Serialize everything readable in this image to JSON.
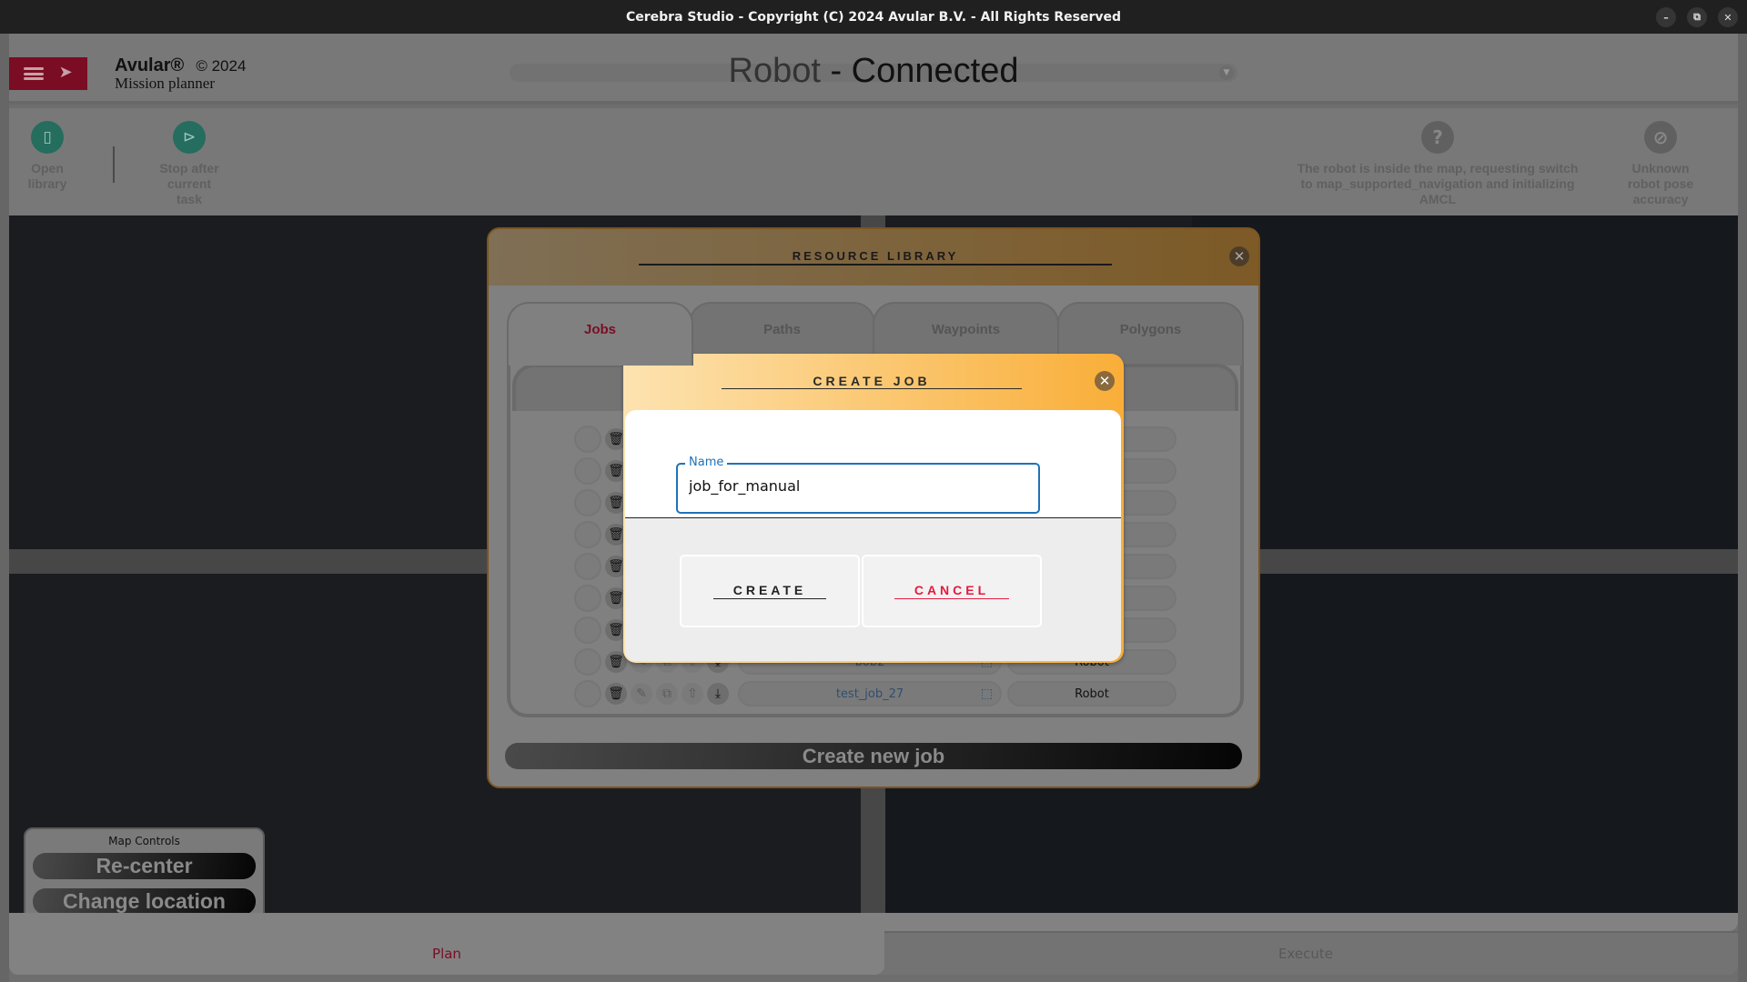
{
  "window": {
    "title": "Cerebra Studio - Copyright (C) 2024 Avular B.V. - All Rights Reserved",
    "controls": {
      "minimize": "–",
      "restore": "⧉",
      "close": "✕"
    }
  },
  "header": {
    "brand_name": "Avular®",
    "brand_copyright": "© 2024",
    "brand_subtitle": "Mission planner",
    "robot_name": "Robot",
    "robot_status": " - Connected",
    "dropdown_arrow": "▼"
  },
  "toolbar": {
    "open_library": {
      "label_line1": "Open",
      "label_line2": "library",
      "icon": "book-icon"
    },
    "stop_after_task": {
      "label_line1": "Stop after",
      "label_line2": "current",
      "label_line3": "task",
      "icon": "stop-after-task-icon"
    },
    "status_message": {
      "line1": "The robot is inside the map, requesting switch",
      "line2": "to map_supported_navigation and initializing",
      "line3": "AMCL",
      "icon": "question-icon"
    },
    "pose_accuracy": {
      "line1": "Unknown",
      "line2": "robot pose",
      "line3": "accuracy",
      "icon": "pose-unknown-icon"
    }
  },
  "map_controls": {
    "title": "Map Controls",
    "recenter": "Re-center",
    "change_location": "Change location"
  },
  "bottom_tabs": {
    "plan": "Plan",
    "execute": "Execute",
    "active": "Plan"
  },
  "resource_library": {
    "title": "RESOURCE LIBRARY",
    "tabs": [
      "Jobs",
      "Paths",
      "Waypoints",
      "Polygons"
    ],
    "active_tab": "Jobs",
    "rows": [
      {
        "name": "",
        "owner": ""
      },
      {
        "name": "",
        "owner": ""
      },
      {
        "name": "",
        "owner": ""
      },
      {
        "name": "",
        "owner": ""
      },
      {
        "name": "",
        "owner": ""
      },
      {
        "name": "",
        "owner": ""
      },
      {
        "name": "",
        "owner": ""
      },
      {
        "name": "bob2",
        "owner": "Robot"
      },
      {
        "name": "test_job_27",
        "owner": "Robot"
      }
    ],
    "create_new_job": "Create new job"
  },
  "create_job_dialog": {
    "title": "CREATE JOB",
    "name_label": "Name",
    "name_value": "job_for_manual",
    "create_label": "CREATE",
    "cancel_label": "CANCEL"
  },
  "colors": {
    "brand_red": "#7a0d23",
    "accent_blue": "#1f72b8",
    "cancel_red": "#e5193f",
    "dialog_gradient_start": "#fde3b0",
    "dialog_gradient_end": "#f9ae38",
    "tool_green": "#256d5e"
  }
}
